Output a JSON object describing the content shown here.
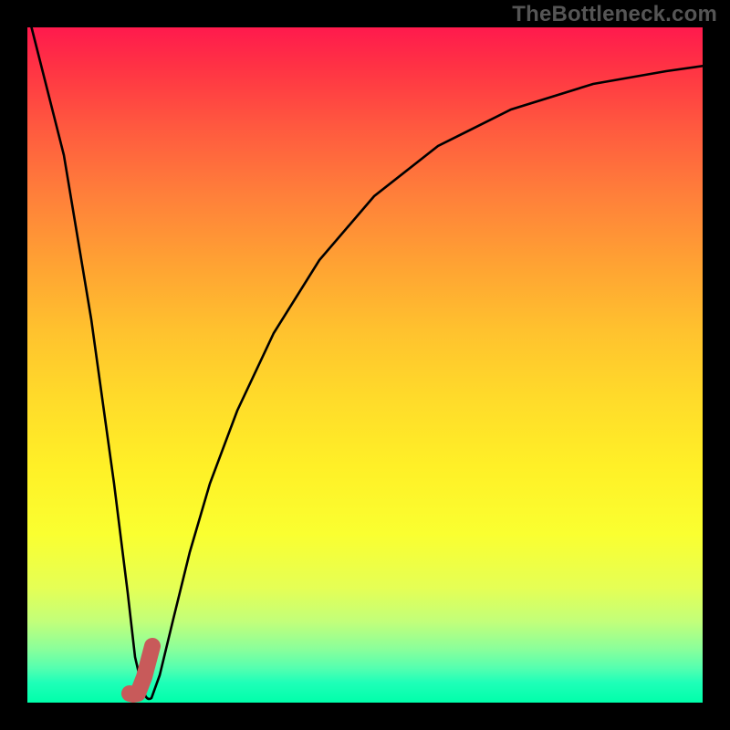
{
  "watermark": "TheBottleneck.com",
  "chart_data": {
    "type": "line",
    "title": "",
    "xlabel": "",
    "ylabel": "",
    "xlim": [
      0,
      100
    ],
    "ylim": [
      0,
      100
    ],
    "grid": false,
    "legend": false,
    "series": [
      {
        "name": "bottleneck-curve",
        "color": "#000000",
        "x": [
          0,
          2,
          4,
          6,
          8,
          10,
          12,
          13,
          14,
          15,
          16,
          18,
          20,
          23,
          26,
          30,
          35,
          40,
          46,
          52,
          60,
          70,
          80,
          90,
          100
        ],
        "y": [
          100,
          87,
          73,
          60,
          47,
          33,
          20,
          13,
          7,
          3,
          1,
          1,
          4,
          11,
          20,
          32,
          45,
          55,
          65,
          72,
          79,
          85,
          89,
          91.5,
          93
        ]
      },
      {
        "name": "target-marker",
        "color": "#c85a5a",
        "shape": "J",
        "x_range": [
          13,
          18
        ],
        "y_range": [
          0,
          8
        ]
      }
    ],
    "gradient_stops": [
      {
        "pct": 0,
        "color": "#ff1a4d"
      },
      {
        "pct": 50,
        "color": "#ffd728"
      },
      {
        "pct": 100,
        "color": "#00ffaa"
      }
    ]
  }
}
